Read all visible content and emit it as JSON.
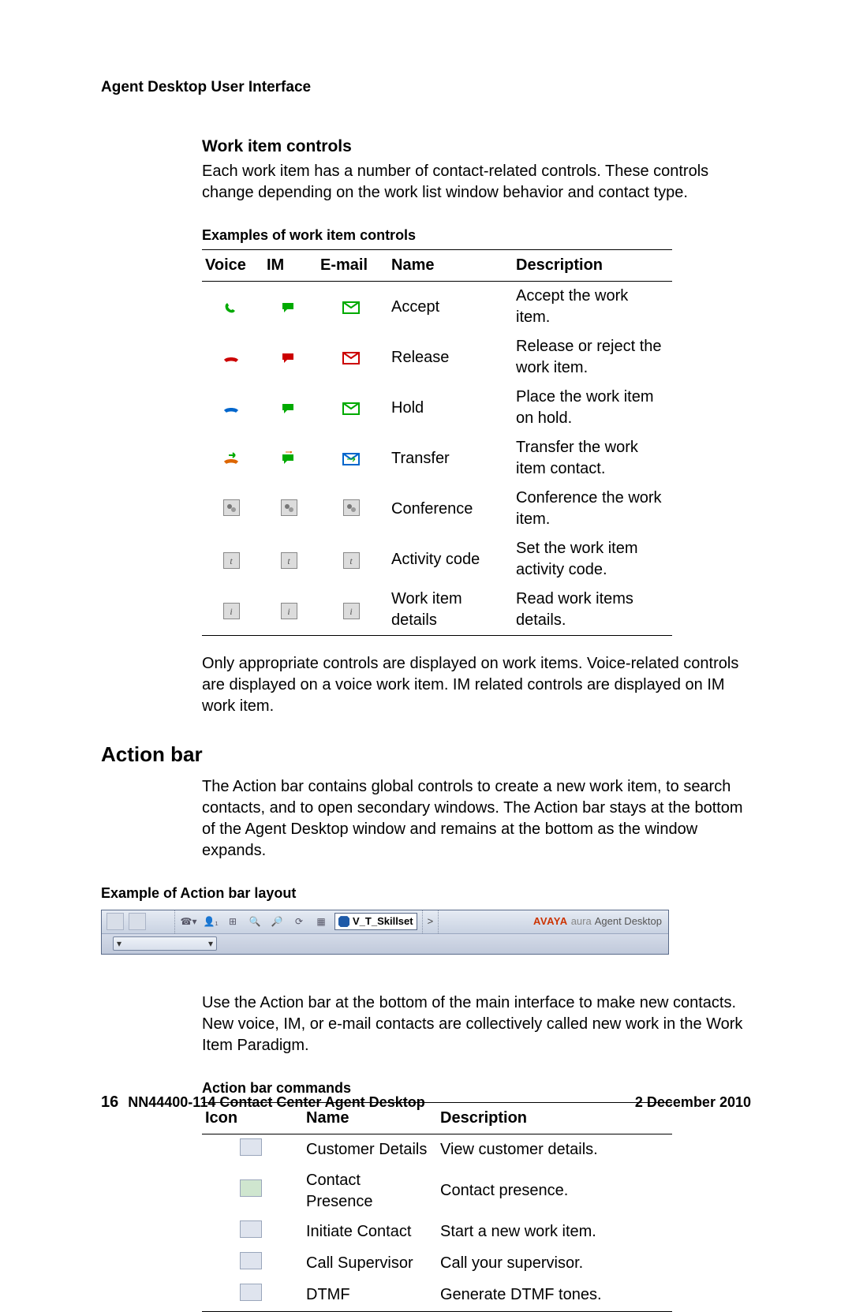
{
  "header": "Agent Desktop User Interface",
  "work_item_controls": {
    "title": "Work item controls",
    "intro": "Each work item has a number of contact-related controls. These controls change depending on the work list window behavior and contact type.",
    "table_caption": "Examples of work item controls",
    "columns": {
      "c1": "Voice",
      "c2": "IM",
      "c3": "E-mail",
      "c4": "Name",
      "c5": "Description"
    },
    "rows": [
      {
        "name": "Accept",
        "desc": "Accept the work item."
      },
      {
        "name": "Release",
        "desc": "Release or reject the work item."
      },
      {
        "name": "Hold",
        "desc": "Place the work item on hold."
      },
      {
        "name": "Transfer",
        "desc": "Transfer the work item contact."
      },
      {
        "name": "Conference",
        "desc": "Conference the work item."
      },
      {
        "name": "Activity code",
        "desc": "Set the work item activity code."
      },
      {
        "name": "Work item details",
        "desc": "Read work items details."
      }
    ],
    "note": "Only appropriate controls are displayed on work items. Voice-related controls are displayed on a voice work item. IM related controls are displayed on IM work item."
  },
  "action_bar": {
    "title": "Action bar",
    "intro": "The Action bar contains global controls to create a new work item, to search contacts, and to open secondary windows. The Action bar stays at the bottom of the Agent Desktop window and remains at the bottom as the window expands.",
    "layout_caption": "Example of Action bar layout",
    "skillset_label": "V_T_Skillset",
    "brand_avaya": "AVAYA",
    "brand_aura": "aura",
    "brand_agent": "Agent Desktop",
    "usage": "Use the Action bar at the bottom of the main interface to make new contacts. New voice, IM, or e-mail contacts are collectively called new work in the Work Item Paradigm.",
    "commands_caption": "Action bar commands",
    "cmd_columns": {
      "c1": "Icon",
      "c2": "Name",
      "c3": "Description"
    },
    "commands": [
      {
        "name": "Customer Details",
        "desc": "View customer details."
      },
      {
        "name": "Contact Presence",
        "desc": "Contact presence."
      },
      {
        "name": "Initiate Contact",
        "desc": "Start a new work item."
      },
      {
        "name": "Call Supervisor",
        "desc": "Call your supervisor."
      },
      {
        "name": "DTMF",
        "desc": "Generate DTMF tones."
      }
    ]
  },
  "footer": {
    "page_number": "16",
    "doc_title": "NN44400-114 Contact Center Agent Desktop",
    "date": "2 December 2010"
  }
}
